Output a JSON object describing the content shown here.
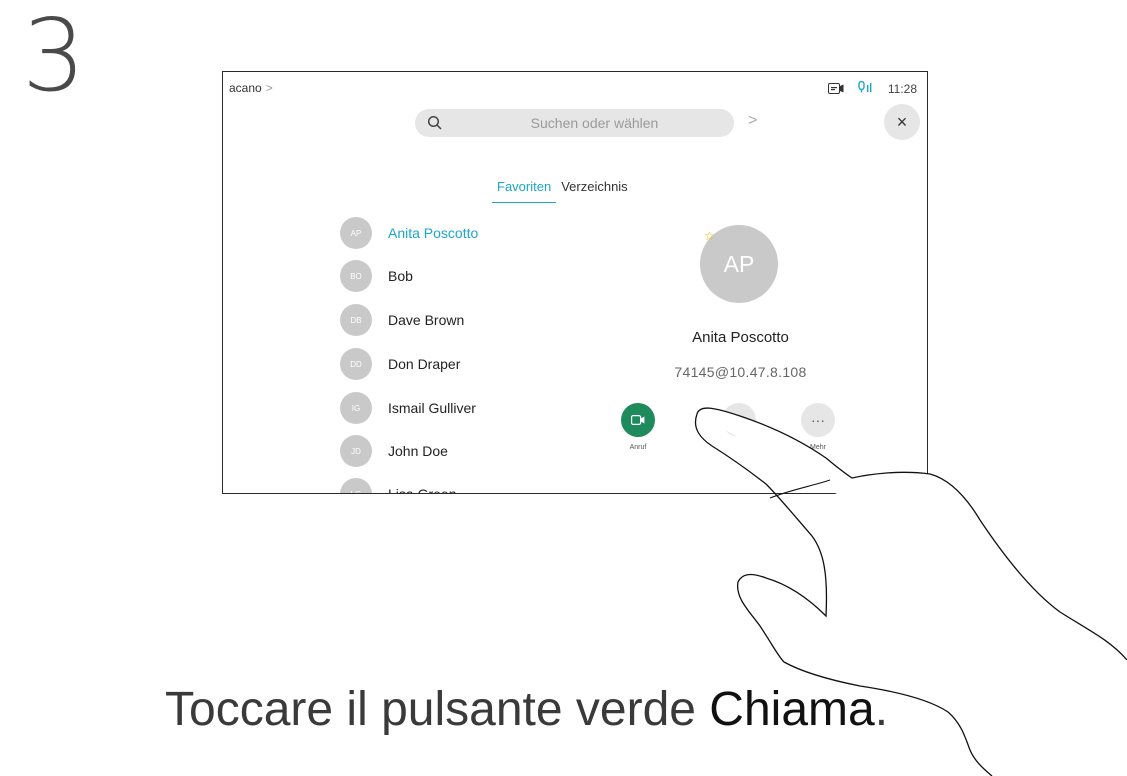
{
  "step": "3",
  "screen": {
    "breadcrumb": "acano",
    "breadcrumb_chevron": ">",
    "time": "11:28",
    "search_placeholder": "Suchen oder wählen",
    "search_go": ">",
    "close_glyph": "×",
    "tabs": [
      {
        "label": "Favoriten",
        "active": true
      },
      {
        "label": "Verzeichnis",
        "active": false
      }
    ],
    "contacts": [
      {
        "initials": "AP",
        "name": "Anita Poscotto",
        "selected": true
      },
      {
        "initials": "BO",
        "name": "Bob"
      },
      {
        "initials": "DB",
        "name": "Dave Brown"
      },
      {
        "initials": "DD",
        "name": "Don Draper"
      },
      {
        "initials": "IG",
        "name": "Ismail Gulliver"
      },
      {
        "initials": "JD",
        "name": "John Doe"
      },
      {
        "initials": "LG",
        "name": "Lisa Green"
      }
    ],
    "detail": {
      "initials": "AP",
      "name": "Anita Poscotto",
      "address": "74145@10.47.8.108",
      "actions": [
        {
          "label": "Anruf",
          "icon": "video-call-icon",
          "color": "#1f8a5b"
        },
        {
          "label": "",
          "icon": "phone-icon",
          "color": "#e6e6e6"
        },
        {
          "label": "Mehr",
          "icon": "more-icon",
          "glyph": "···",
          "color": "#e6e6e6"
        }
      ]
    },
    "accent_color": "#1aa7c9"
  },
  "instruction": {
    "prefix": "Toccare il pulsante verde ",
    "bold": "Chiama",
    "suffix": "."
  }
}
